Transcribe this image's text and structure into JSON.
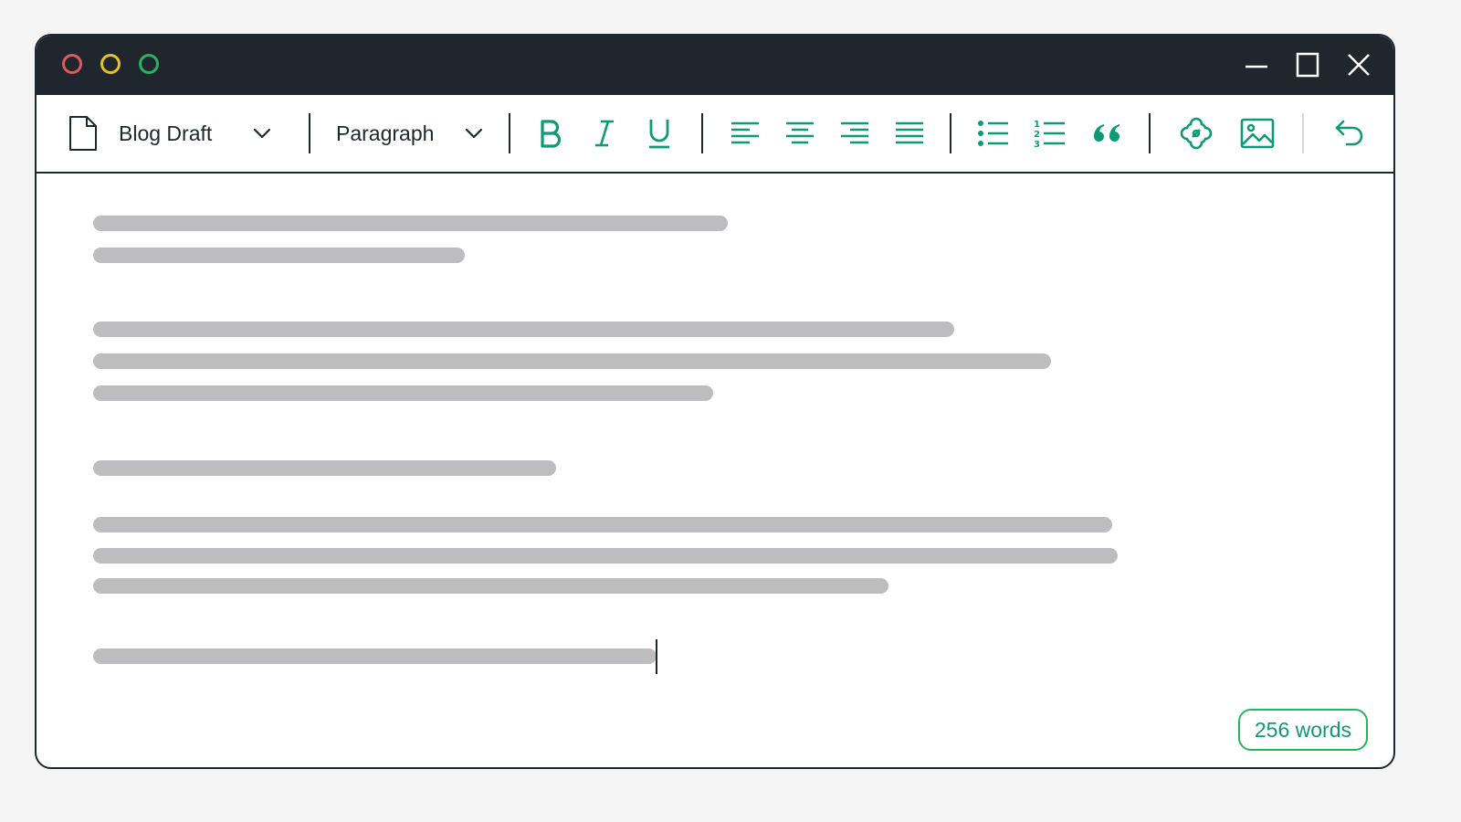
{
  "window": {
    "controls": [
      "close-dot",
      "minimize-dot",
      "zoom-dot"
    ],
    "window_buttons": [
      "minimize-icon",
      "maximize-icon",
      "close-icon"
    ]
  },
  "toolbar": {
    "document": {
      "icon": "document-icon",
      "title": "Blog Draft",
      "dropdown_icon": "chevron-down-icon"
    },
    "block_format": {
      "selected": "Paragraph",
      "dropdown_icon": "chevron-down-icon"
    },
    "formatting": [
      "bold-icon",
      "italic-icon",
      "underline-icon"
    ],
    "alignment": [
      "align-left-icon",
      "align-center-icon",
      "align-right-icon",
      "align-justify-icon"
    ],
    "lists": [
      "bullet-list-icon",
      "numbered-list-icon",
      "blockquote-icon"
    ],
    "insert": [
      "link-icon",
      "image-icon"
    ],
    "history": [
      "undo-icon"
    ]
  },
  "colors": {
    "titlebar": "#1f262e",
    "accent": "#0f9a76",
    "badge_border": "#27b45f",
    "placeholder_line": "#bdbdc0"
  },
  "status": {
    "word_count": "256 words"
  }
}
